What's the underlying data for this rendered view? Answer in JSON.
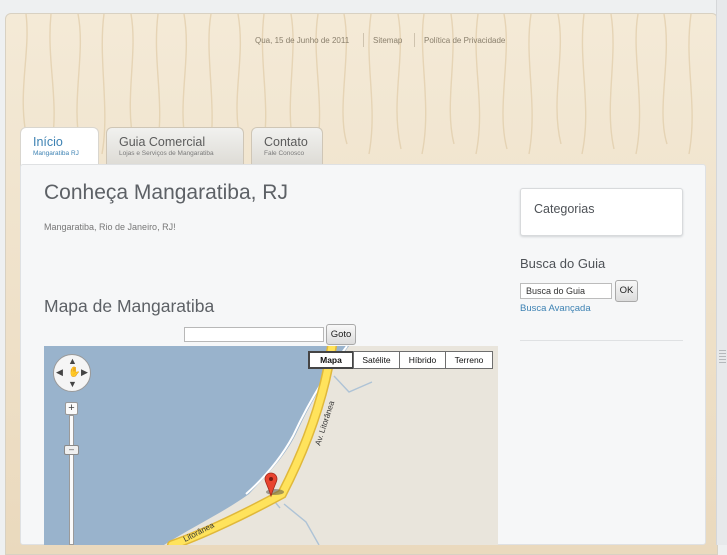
{
  "header": {
    "date": "Qua, 15 de Junho de 2011",
    "sitemap": "Sitemap",
    "privacy": "Política de Privacidade"
  },
  "tabs": [
    {
      "title": "Início",
      "subtitle": "Mangaratiba RJ",
      "active": true
    },
    {
      "title": "Guia Comercial",
      "subtitle": "Lojas e Serviços de Mangaratiba",
      "active": false
    },
    {
      "title": "Contato",
      "subtitle": "Fale Conosco",
      "active": false
    }
  ],
  "main": {
    "title": "Conheça Mangaratiba, RJ",
    "subtitle": "Mangaratiba, Rio de Janeiro, RJ!",
    "map_heading": "Mapa de Mangaratiba",
    "goto_button": "Goto",
    "goto_value": ""
  },
  "map": {
    "types": [
      "Mapa",
      "Satélite",
      "Híbrido",
      "Terreno"
    ],
    "selected_type": "Mapa",
    "road_labels": [
      "Av. Litorânea",
      "Litorânea"
    ],
    "colors": {
      "water": "#99b3cc",
      "land": "#e9e5dc",
      "road": "#ffe35c",
      "road_border": "#e0b83a",
      "marker": "#e8442f"
    }
  },
  "sidebar": {
    "categories_title": "Categorias",
    "search_title": "Busca do Guia",
    "search_value": "Busca do Guia",
    "ok_button": "OK",
    "advanced_link": "Busca Avançada"
  },
  "icons": {
    "pan": "pan-control-icon",
    "hand": "hand-icon",
    "zoom_in": "zoom-plus-icon",
    "marker": "map-marker-icon"
  }
}
